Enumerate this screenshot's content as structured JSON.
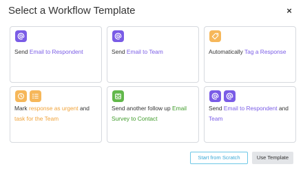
{
  "dialog": {
    "title": "Select a Workflow Template",
    "close_symbol": "×"
  },
  "templates": [
    {
      "icons": [
        "at-icon"
      ],
      "parts": [
        {
          "text": "Send "
        },
        {
          "text": "Email to Respondent",
          "color": "purple"
        }
      ]
    },
    {
      "icons": [
        "at-icon"
      ],
      "parts": [
        {
          "text": "Send "
        },
        {
          "text": "Email to Team",
          "color": "purple"
        }
      ]
    },
    {
      "icons": [
        "tag-icon"
      ],
      "parts": [
        {
          "text": "Automatically "
        },
        {
          "text": "Tag a Response",
          "color": "purple"
        }
      ]
    },
    {
      "icons": [
        "urgent-clock-icon",
        "task-list-icon"
      ],
      "parts": [
        {
          "text": "Mark "
        },
        {
          "text": "response as urgent",
          "color": "orange"
        },
        {
          "text": " and "
        },
        {
          "text": "task for the Team",
          "color": "orange"
        }
      ]
    },
    {
      "icons": [
        "survey-inbox-icon"
      ],
      "parts": [
        {
          "text": "Send another follow up "
        },
        {
          "text": "Email Survey to Contact",
          "color": "green"
        }
      ]
    },
    {
      "icons": [
        "at-icon",
        "at-icon"
      ],
      "parts": [
        {
          "text": "Send "
        },
        {
          "text": "Email to Respondent",
          "color": "purple"
        },
        {
          "text": " and "
        },
        {
          "text": "Team",
          "color": "purple"
        }
      ]
    }
  ],
  "actions": {
    "start_from_scratch": "Start from Scratch",
    "use_template": "Use Template"
  },
  "colors": {
    "purple": "#7a5ce6",
    "orange": "#f6b75a",
    "green": "#62b84b",
    "accent_blue": "#3aa8d6"
  }
}
